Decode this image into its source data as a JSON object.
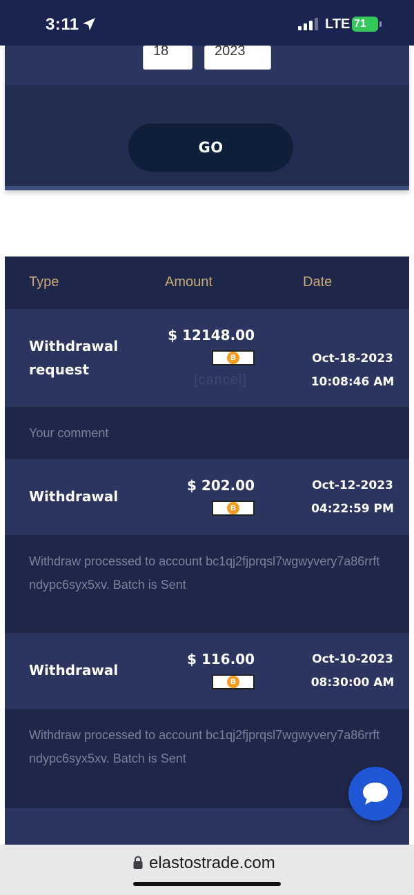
{
  "status_bar": {
    "time": "3:11",
    "network": "LTE",
    "battery": "71"
  },
  "filter": {
    "day_value": "18",
    "year_value": "2023",
    "go_label": "GO"
  },
  "table": {
    "headers": {
      "type": "Type",
      "amount": "Amount",
      "date": "Date"
    },
    "rows": [
      {
        "type": "Withdrawal request",
        "amount": "$ 12148.00",
        "cancel": "[cancel]",
        "date": "Oct-18-2023",
        "time": "10:08:46 AM",
        "comment": "Your comment"
      },
      {
        "type": "Withdrawal",
        "amount": "$ 202.00",
        "date": "Oct-12-2023",
        "time": "04:22:59 PM",
        "comment": "Withdraw processed to account bc1qj2fjprqsl7wgwyvery7a86rrftndypc6syx5xv. Batch is Sent"
      },
      {
        "type": "Withdrawal",
        "amount": "$ 116.00",
        "date": "Oct-10-2023",
        "time": "08:30:00 AM",
        "comment": "Withdraw processed to account bc1qj2fjprqsl7wgwyvery7a86rrftndypc6syx5xv. Batch is Sent"
      }
    ],
    "coin_icon": "bitcoin-icon",
    "coin_symbol": "B"
  },
  "browser": {
    "url": "elastostrade.com"
  },
  "colors": {
    "header_bg": "#1b2451",
    "row_bg": "#2b3560",
    "comment_bg": "#1e2749",
    "header_text": "#c9a977",
    "chat_button": "#1e56d6",
    "battery": "#34c759",
    "bitcoin": "#f39c1f"
  }
}
